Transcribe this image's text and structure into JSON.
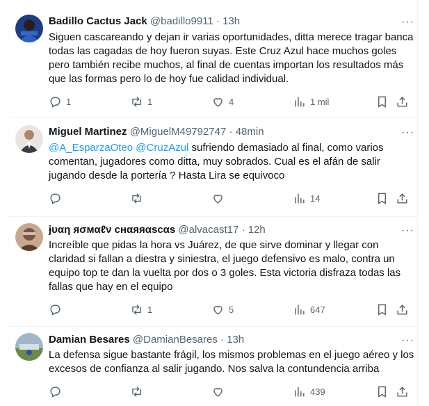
{
  "tweets": [
    {
      "name": "Badillo Cactus Jack",
      "handle": "@badillo9911",
      "dot": "·",
      "time": "13h",
      "more": "···",
      "text": "Siguen cascareando y dejan ir varias oportunidades, ditta merece tragar banca todas las cagadas de hoy fueron suyas. Este Cruz Azul hace muchos goles pero también recibe muchos, al final de cuentas importan los resultados más que las formas pero lo de hoy fue calidad individual.",
      "replies": "1",
      "retweets": "1",
      "likes": "4",
      "views": "1 mil",
      "avatar_colors": [
        "#2b4fa0",
        "#1a2f66"
      ]
    },
    {
      "name": "Miguel Martinez",
      "handle": "@MiguelM49792747",
      "dot": "·",
      "time": "48min",
      "more": "···",
      "mention1": "@A_EsparzaOteo",
      "mention2": "@CruzAzul",
      "text": " sufriendo demasiado al final, como varios comentan, jugadores como ditta, muy sobrados. Cual es el afán de salir jugando desde la portería  ? Hasta Lira se equivoco",
      "replies": "",
      "retweets": "",
      "likes": "",
      "views": "14",
      "avatar_colors": [
        "#e9e6e1",
        "#3a3a44"
      ]
    },
    {
      "name": "ɉυαη яσмαℓν cнαяяαѕcαѕ",
      "handle": "@alvacast17",
      "dot": "·",
      "time": "12h",
      "more": "···",
      "text": "Increíble que pidas la hora vs Juárez, de que sirve dominar y llegar con claridad si fallan a diestra y siniestra, el juego defensivo es malo, contra un equipo top te dan la vuelta por dos o 3 goles. Esta victoria disfraza todas las fallas que hay en el equipo",
      "replies": "",
      "retweets": "1",
      "likes": "5",
      "views": "647",
      "avatar_colors": [
        "#c9a78c",
        "#5a3b2e"
      ]
    },
    {
      "name": "Damian Besares",
      "handle": "@DamianBesares",
      "dot": "·",
      "time": "13h",
      "more": "···",
      "text": "La defensa sigue bastante frágil, los mismos problemas en el juego aéreo y los excesos de confianza al salir jugando. Nos salva la contundencia arriba",
      "replies": "",
      "retweets": "",
      "likes": "",
      "views": "439",
      "avatar_colors": [
        "#9fb7c9",
        "#6a8a4a"
      ]
    }
  ],
  "icons": {
    "reply": "reply-icon",
    "retweet": "retweet-icon",
    "like": "like-icon",
    "views": "views-icon",
    "bookmark": "bookmark-icon",
    "share": "share-icon"
  }
}
